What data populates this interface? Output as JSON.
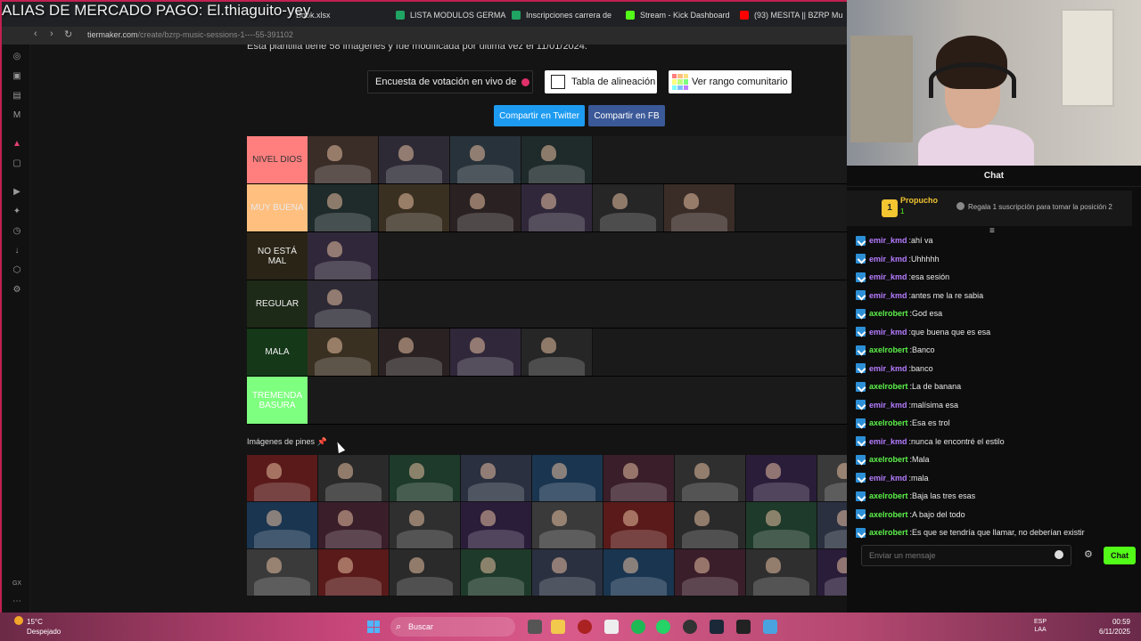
{
  "overlay": {
    "stream_title": "ALIAS DE MERCADO PAGO: El.thiaguito-yey"
  },
  "browser": {
    "tabs": [
      {
        "label": "LISTA MODULOS GERMA",
        "color": "#1fa463"
      },
      {
        "label": "Inscripciones carrera de",
        "color": "#1fa463"
      },
      {
        "label": "Stream - Kick Dashboard",
        "color": "#53fc18"
      },
      {
        "label": "(93) MESITA || BZRP Mu",
        "color": "#ff0000"
      }
    ],
    "partial_tab": "Book.xlsx",
    "url_domain": "tiermaker.com",
    "url_path": "/create/bzrp-music-sessions-1----55-391102"
  },
  "page": {
    "info_text": "Esta plantilla tiene 58 imágenes y fue modificada por última vez el 11/01/2024.",
    "poll_button": "Encuesta de votación en vivo de",
    "align_button": "Tabla de alineación",
    "rank_button": "Ver rango comunitario",
    "share_twitter": "Compartir en Twitter",
    "share_fb": "Compartir en FB",
    "pins_label": "Imágenes de pines"
  },
  "tiers": [
    {
      "label": "NIVEL DIOS",
      "color": "#ff7f7f",
      "text_color": "#333333",
      "count": 4
    },
    {
      "label": "MUY BUENA",
      "color": "#ffbf7f",
      "text_color": "#e8e8e8",
      "count": 6
    },
    {
      "label": "NO ESTÁ MAL",
      "color": "#2a2416",
      "text_color": "#f0f0f0",
      "count": 1
    },
    {
      "label": "REGULAR",
      "color": "#1e2a18",
      "text_color": "#f0f0f0",
      "count": 1
    },
    {
      "label": "MALA",
      "color": "#143818",
      "text_color": "#f0f0f0",
      "count": 4
    },
    {
      "label": "TREMENDA BASURA",
      "color": "#7fff7f",
      "text_color": "#ffffff",
      "count": 0
    }
  ],
  "chat": {
    "title": "Chat",
    "pinned_user": "Propucho",
    "pinned_rank": "1",
    "pinned_badge": "1",
    "gift_text": "Regala 1 suscripción para tomar la posición 2",
    "input_placeholder": "Enviar un mensaje",
    "send_label": "Chat",
    "messages": [
      {
        "user": "emir_kmd",
        "text": "ahí va",
        "color": "#b57cff"
      },
      {
        "user": "emir_kmd",
        "text": "Uhhhhh",
        "color": "#b57cff"
      },
      {
        "user": "emir_kmd",
        "text": "esa sesión",
        "color": "#b57cff"
      },
      {
        "user": "emir_kmd",
        "text": "antes me la re sabia",
        "color": "#b57cff"
      },
      {
        "user": "axelrobert",
        "text": "God esa",
        "color": "#5cf24a"
      },
      {
        "user": "emir_kmd",
        "text": "que buena que es esa",
        "color": "#b57cff"
      },
      {
        "user": "axelrobert",
        "text": "Banco",
        "color": "#5cf24a"
      },
      {
        "user": "emir_kmd",
        "text": "banco",
        "color": "#b57cff"
      },
      {
        "user": "axelrobert",
        "text": "La de banana",
        "color": "#5cf24a"
      },
      {
        "user": "emir_kmd",
        "text": "malísima esa",
        "color": "#b57cff"
      },
      {
        "user": "axelrobert",
        "text": "Esa es trol",
        "color": "#5cf24a"
      },
      {
        "user": "emir_kmd",
        "text": "nunca le encontré el estilo",
        "color": "#b57cff"
      },
      {
        "user": "axelrobert",
        "text": "Mala",
        "color": "#5cf24a"
      },
      {
        "user": "emir_kmd",
        "text": "mala",
        "color": "#b57cff"
      },
      {
        "user": "axelrobert",
        "text": "Baja las tres esas",
        "color": "#5cf24a"
      },
      {
        "user": "axelrobert",
        "text": "A bajo del todo",
        "color": "#5cf24a"
      },
      {
        "user": "axelrobert",
        "text": "Es que se tendría que llamar, no deberían existir",
        "color": "#5cf24a"
      }
    ]
  },
  "taskbar": {
    "temp": "15°C",
    "weather": "Despejado",
    "search": "Buscar",
    "lang1": "ESP",
    "lang2": "LAA",
    "time": "00:59",
    "date": "6/11/2025"
  }
}
